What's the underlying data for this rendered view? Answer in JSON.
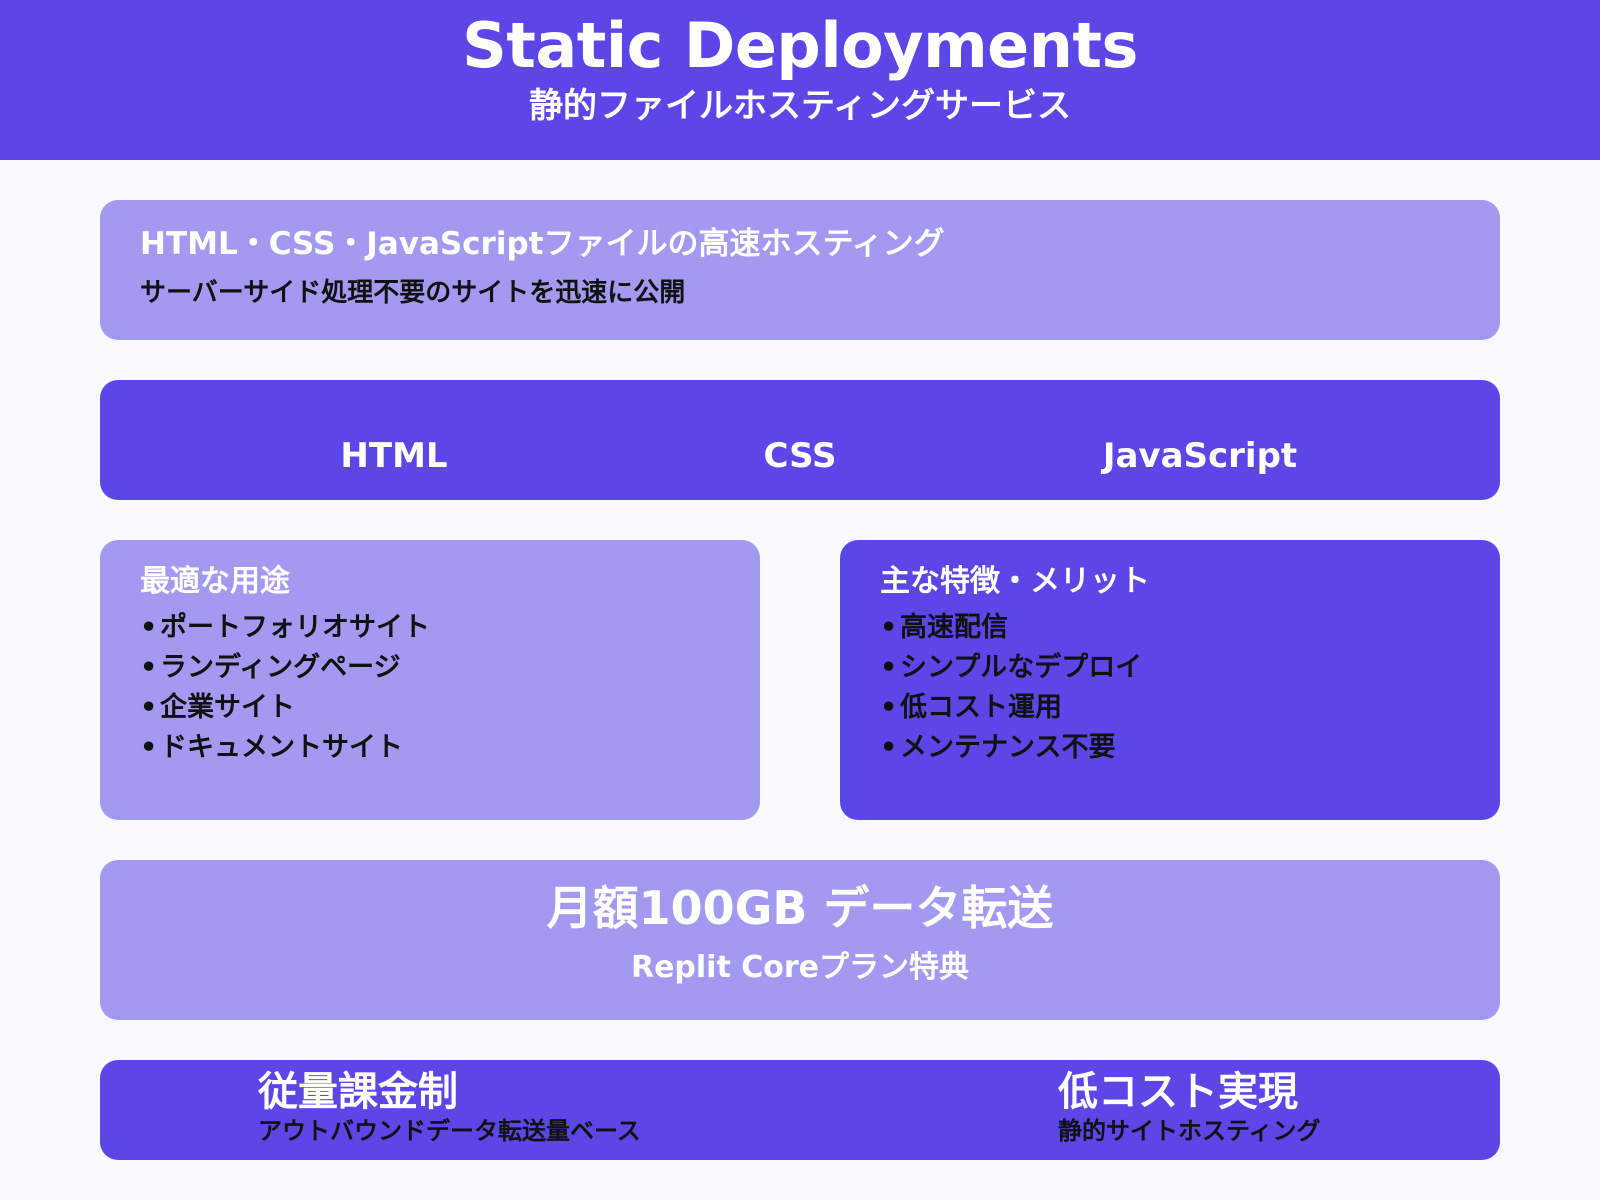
{
  "header": {
    "title": "Static Deployments",
    "subtitle": "静的ファイルホスティングサービス"
  },
  "intro": {
    "title": "HTML・CSS・JavaScriptファイルの高速ホスティング",
    "description": "サーバーサイド処理不要のサイトを迅速に公開"
  },
  "tech": {
    "items": [
      "HTML",
      "CSS",
      "JavaScript"
    ]
  },
  "use_cases": {
    "title": "最適な用途",
    "items": [
      "ポートフォリオサイト",
      "ランディングページ",
      "企業サイト",
      "ドキュメントサイト"
    ]
  },
  "features": {
    "title": "主な特徴・メリット",
    "items": [
      "高速配信",
      "シンプルなデプロイ",
      "低コスト運用",
      "メンテナンス不要"
    ]
  },
  "plan": {
    "headline": "月額100GB データ転送",
    "note": "Replit Coreプラン特典"
  },
  "bottom": {
    "left_title": "従量課金制",
    "left_sub": "アウトバウンドデータ転送量ベース",
    "right_title": "低コスト実現",
    "right_sub": "静的サイトホスティング"
  },
  "bullet": "•",
  "colors": {
    "primary": "#5c46e8",
    "light": "#a399f0",
    "background": "#f9f9fd"
  }
}
